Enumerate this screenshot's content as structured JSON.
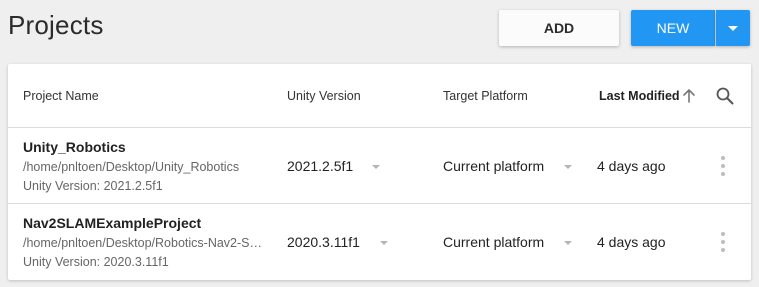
{
  "header": {
    "title": "Projects",
    "add_label": "ADD",
    "new_label": "NEW"
  },
  "table": {
    "columns": {
      "name": "Project Name",
      "version": "Unity Version",
      "platform": "Target Platform",
      "modified": "Last Modified"
    },
    "rows": [
      {
        "name": "Unity_Robotics",
        "path": "/home/pnltoen/Desktop/Unity_Robotics",
        "version_info": "Unity Version: 2021.2.5f1",
        "version": "2021.2.5f1",
        "platform": "Current platform",
        "modified": "4 days ago"
      },
      {
        "name": "Nav2SLAMExampleProject",
        "path": "/home/pnltoen/Desktop/Robotics-Nav2-S…",
        "version_info": "Unity Version: 2020.3.11f1",
        "version": "2020.3.11f1",
        "platform": "Current platform",
        "modified": "4 days ago"
      }
    ]
  },
  "colors": {
    "accent": "#2196f3",
    "background": "#efefef"
  },
  "icons": {
    "dropdown": "chevron-down-icon",
    "sort": "arrow-up-icon",
    "search": "search-icon",
    "more": "more-vertical-icon"
  }
}
